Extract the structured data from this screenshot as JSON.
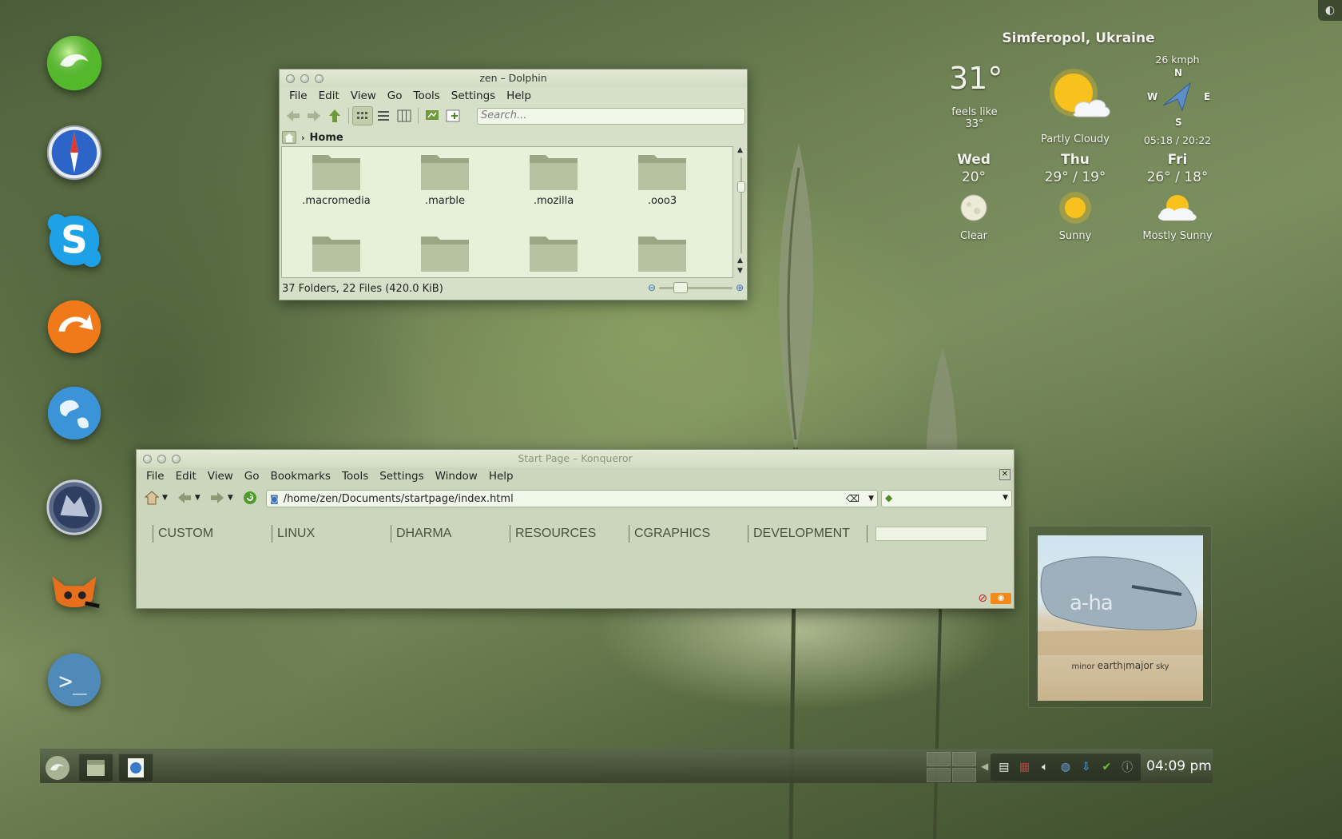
{
  "dock": {
    "items": [
      "suse-launcher-icon",
      "safari-compass-icon",
      "skype-icon",
      "sync-arrow-icon",
      "globe-icon",
      "wolf-app-icon",
      "gimp-icon",
      "terminal-icon"
    ]
  },
  "dolphin": {
    "title": "zen – Dolphin",
    "menu": [
      "File",
      "Edit",
      "View",
      "Go",
      "Tools",
      "Settings",
      "Help"
    ],
    "search_placeholder": "Search...",
    "breadcrumb": "Home",
    "files": [
      ".macromedia",
      ".marble",
      ".mozilla",
      ".ooo3",
      "",
      "",
      "",
      ""
    ],
    "status": "37 Folders, 22 Files (420.0 KiB)",
    "zoom_level": 0.25
  },
  "konqueror": {
    "title": "Start Page – Konqueror",
    "menu": [
      "File",
      "Edit",
      "View",
      "Go",
      "Bookmarks",
      "Tools",
      "Settings",
      "Window",
      "Help"
    ],
    "url": "/home/zen/Documents/startpage/index.html",
    "nav_links": [
      "CUSTOM",
      "LINUX",
      "DHARMA",
      "RESOURCES",
      "CGRAPHICS",
      "DEVELOPMENT"
    ]
  },
  "weather": {
    "city": "Simferopol, Ukraine",
    "temperature": "31°",
    "feels_like": "feels like",
    "feels_temp": "33°",
    "condition": "Partly Cloudy",
    "wind_speed": "26 kmph",
    "compass": {
      "n": "N",
      "s": "S",
      "e": "E",
      "w": "W"
    },
    "sunrise_sunset": "05:18 / 20:22",
    "forecast": [
      {
        "day": "Wed",
        "temp": "20°",
        "label": "Clear",
        "icon": "moon-icon"
      },
      {
        "day": "Thu",
        "temp": "29° / 19°",
        "label": "Sunny",
        "icon": "sun-icon"
      },
      {
        "day": "Fri",
        "temp": "26° / 18°",
        "label": "Mostly Sunny",
        "icon": "sun-cloud-icon"
      }
    ]
  },
  "album": {
    "artist_logo": "a-ha",
    "subtitle_a": "minor",
    "subtitle_b": "earth",
    "subtitle_c": "major",
    "subtitle_d": "sky"
  },
  "taskbar": {
    "clock": "04:09 pm",
    "tray_icons": [
      "clipboard-icon",
      "us-flag-icon",
      "volume-icon",
      "network-globe-icon",
      "download-icon",
      "check-shield-icon",
      "info-icon"
    ]
  },
  "colors": {
    "window_bg": "#d6dfc7",
    "accent_green": "#6a8f3c"
  }
}
